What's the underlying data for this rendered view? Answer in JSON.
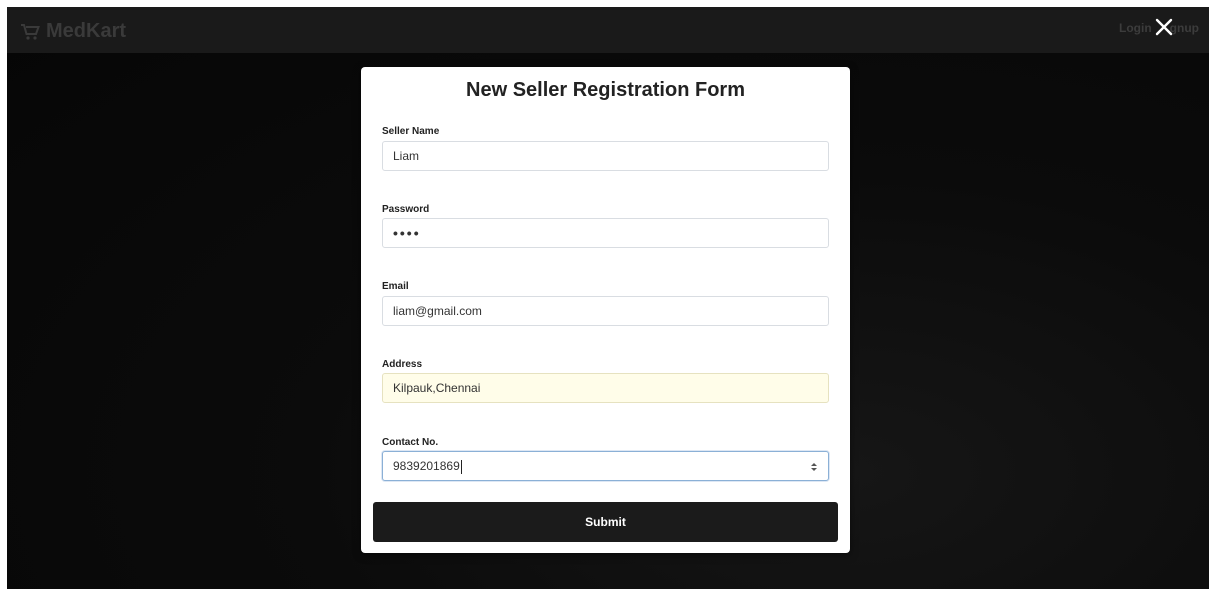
{
  "navbar": {
    "brand": "MedKart",
    "brand_icon": "cart-icon",
    "login_label": "Login",
    "signup_label": "gnup",
    "close_icon": "close-icon"
  },
  "form": {
    "title": "New Seller Registration Form",
    "fields": [
      {
        "label": "Seller Name",
        "value": "Liam"
      },
      {
        "label": "Password",
        "value": "••••"
      },
      {
        "label": "Email",
        "value": "liam@gmail.com"
      },
      {
        "label": "Address",
        "value": "Kilpauk,Chennai"
      },
      {
        "label": "Contact No.",
        "value": "9839201869"
      }
    ],
    "submit_label": "Submit"
  },
  "colors": {
    "navbar_bg": "#1a1a1a",
    "button_bg": "#1b1b1b",
    "autofill_bg": "#fffde9",
    "focus_border": "#8bb0d6"
  }
}
